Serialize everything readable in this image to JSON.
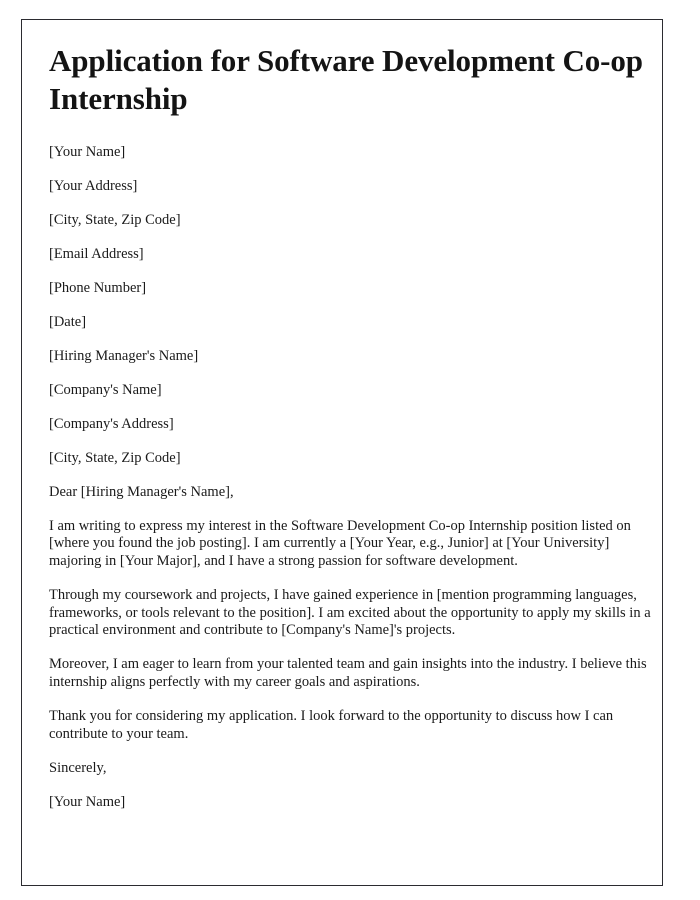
{
  "document": {
    "title": "Application for Software Development Co-op Internship",
    "sender_block": [
      "[Your Name]",
      "[Your Address]",
      "[City, State, Zip Code]",
      "[Email Address]",
      "[Phone Number]"
    ],
    "date_line": "[Date]",
    "recipient_block": [
      "[Hiring Manager's Name]",
      "[Company's Name]",
      "[Company's Address]",
      "[City, State, Zip Code]"
    ],
    "salutation": "Dear [Hiring Manager's Name],",
    "paragraphs": [
      "I am writing to express my interest in the Software Development Co-op Internship position listed on [where you found the job posting]. I am currently a [Your Year, e.g., Junior] at [Your University] majoring in [Your Major], and I have a strong passion for software development.",
      "Through my coursework and projects, I have gained experience in [mention programming languages, frameworks, or tools relevant to the position]. I am excited about the opportunity to apply my skills in a practical environment and contribute to [Company's Name]'s projects.",
      "Moreover, I am eager to learn from your talented team and gain insights into the industry. I believe this internship aligns perfectly with my career goals and aspirations.",
      "Thank you for considering my application. I look forward to the opportunity to discuss how I can contribute to your team."
    ],
    "closing": "Sincerely,",
    "signature_name": "[Your Name]"
  },
  "colors": {
    "page_background": "#ffffff",
    "text": "#1a1a1a",
    "border": "#2b2b30"
  }
}
